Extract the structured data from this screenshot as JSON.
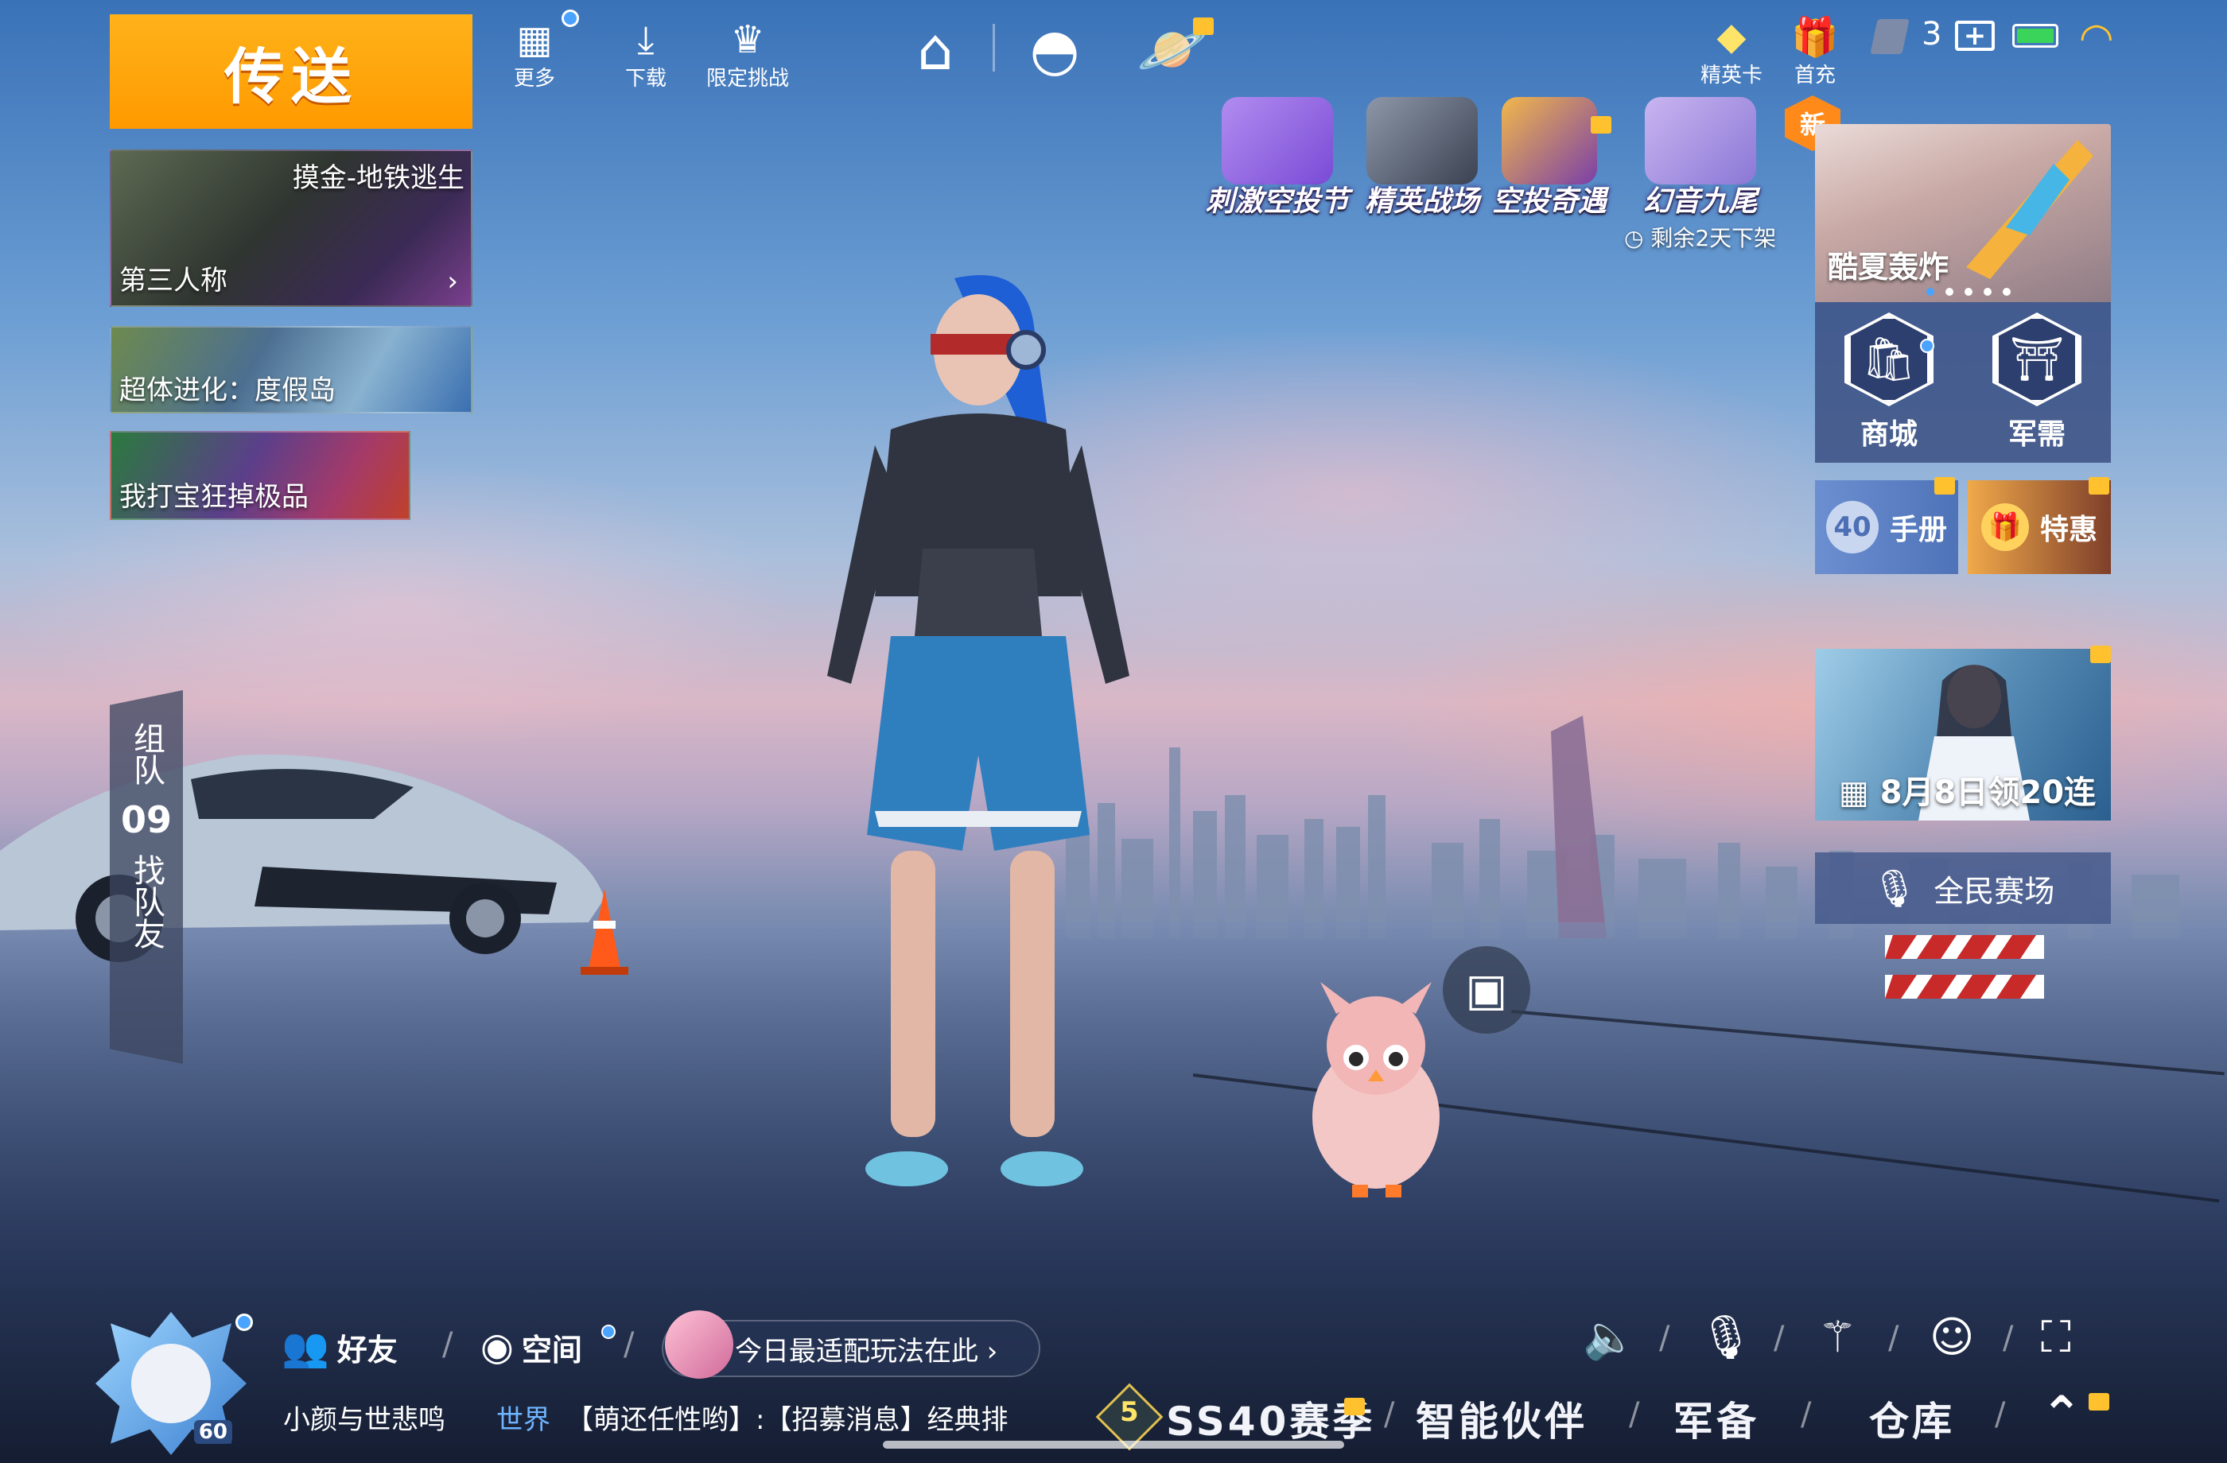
{
  "top_left": {
    "teleport_label": "传送",
    "modes": [
      {
        "title": "摸金-地铁逃生",
        "subtitle": "第三人称"
      },
      {
        "title": "超体进化：度假岛"
      },
      {
        "title": "我打宝狂掉极品"
      }
    ]
  },
  "toolbar": {
    "more_label": "更多",
    "download_label": "下载",
    "challenge_label": "限定挑战"
  },
  "top_right": {
    "elite_card_label": "精英卡",
    "first_recharge_label": "首充",
    "notification_count": "3"
  },
  "events": [
    {
      "label": "刺激空投节"
    },
    {
      "label": "精英战场"
    },
    {
      "label": "空投奇遇"
    },
    {
      "label": "幻音九尾",
      "note": "剩余2天下架",
      "badge": "新"
    }
  ],
  "right_panel": {
    "promo_label": "酷夏轰炸",
    "shop_label": "商城",
    "supply_label": "军需",
    "handbook_label": "手册",
    "handbook_number": "40",
    "deal_label": "特惠",
    "gift_banner": "8月8日领20连",
    "arena_label": "全民赛场"
  },
  "team_panel": {
    "team_label": "组队",
    "count": "09",
    "find_label": "找队友"
  },
  "bottom": {
    "avatar_level": "60",
    "friends_label": "好友",
    "space_label": "空间",
    "pill_text": "今日最适配玩法在此 ›",
    "player_name": "小颜与世悲鸣",
    "channel": "世界",
    "chat_message": "【萌还任性哟】:【招募消息】经典排",
    "season_label": "SS40赛季",
    "season_rank": "5",
    "partner_label": "智能伙伴",
    "gear_label": "军备",
    "warehouse_label": "仓库"
  },
  "colors": {
    "teleport_orange": "#ffa400",
    "accent_blue": "#4aa3ff",
    "gift_gold": "#ffc22e",
    "battery_green": "#3bd45a"
  },
  "icons": [
    "grid-icon",
    "download-icon",
    "wings-icon",
    "home-icon",
    "helmet-icon",
    "planet-icon",
    "diamond-icon",
    "gift-box-icon",
    "battery-icon",
    "wifi-icon",
    "friends-icon",
    "space-icon",
    "speaker-icon",
    "mic-icon",
    "magic-wand-icon",
    "emoji-icon",
    "fullscreen-icon",
    "camera-icon",
    "up-arrow-icon"
  ]
}
